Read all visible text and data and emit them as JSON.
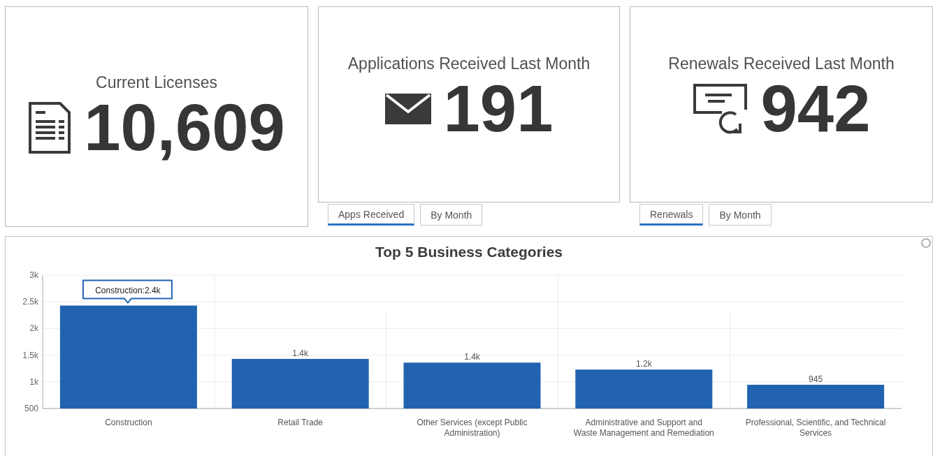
{
  "cards": [
    {
      "title": "Current Licenses",
      "value": "10,609"
    },
    {
      "title": "Applications Received Last Month",
      "value": "191",
      "tabs": [
        {
          "label": "Apps Received",
          "selected": true
        },
        {
          "label": "By Month",
          "selected": false
        }
      ]
    },
    {
      "title": "Renewals Received Last Month",
      "value": "942",
      "tabs": [
        {
          "label": "Renewals",
          "selected": true
        },
        {
          "label": "By Month",
          "selected": false
        }
      ]
    }
  ],
  "chart_panel": {
    "tooltip": "Construction:2.4k",
    "chart_data": {
      "type": "bar",
      "title": "Top 5 Business Categories",
      "categories": [
        "Construction",
        "Retail Trade",
        "Other Services (except Public Administration)",
        "Administrative and Support and Waste Management and Remediation",
        "Professional, Scientific, and Technical Services"
      ],
      "series": [
        {
          "color": "#2163b0",
          "values": [
            2430,
            1430,
            1360,
            1230,
            945
          ]
        }
      ],
      "value_labels": [
        null,
        "1.4k",
        "1.4k",
        "1.2k",
        "945"
      ],
      "grid": true,
      "ylim": [
        500,
        3000
      ],
      "yticks": [
        {
          "value": 500,
          "label": "500"
        },
        {
          "value": 1000,
          "label": "1k"
        },
        {
          "value": 1500,
          "label": "1.5k"
        },
        {
          "value": 2000,
          "label": "2k"
        },
        {
          "value": 2500,
          "label": "2.5k"
        },
        {
          "value": 3000,
          "label": "3k"
        }
      ]
    }
  }
}
